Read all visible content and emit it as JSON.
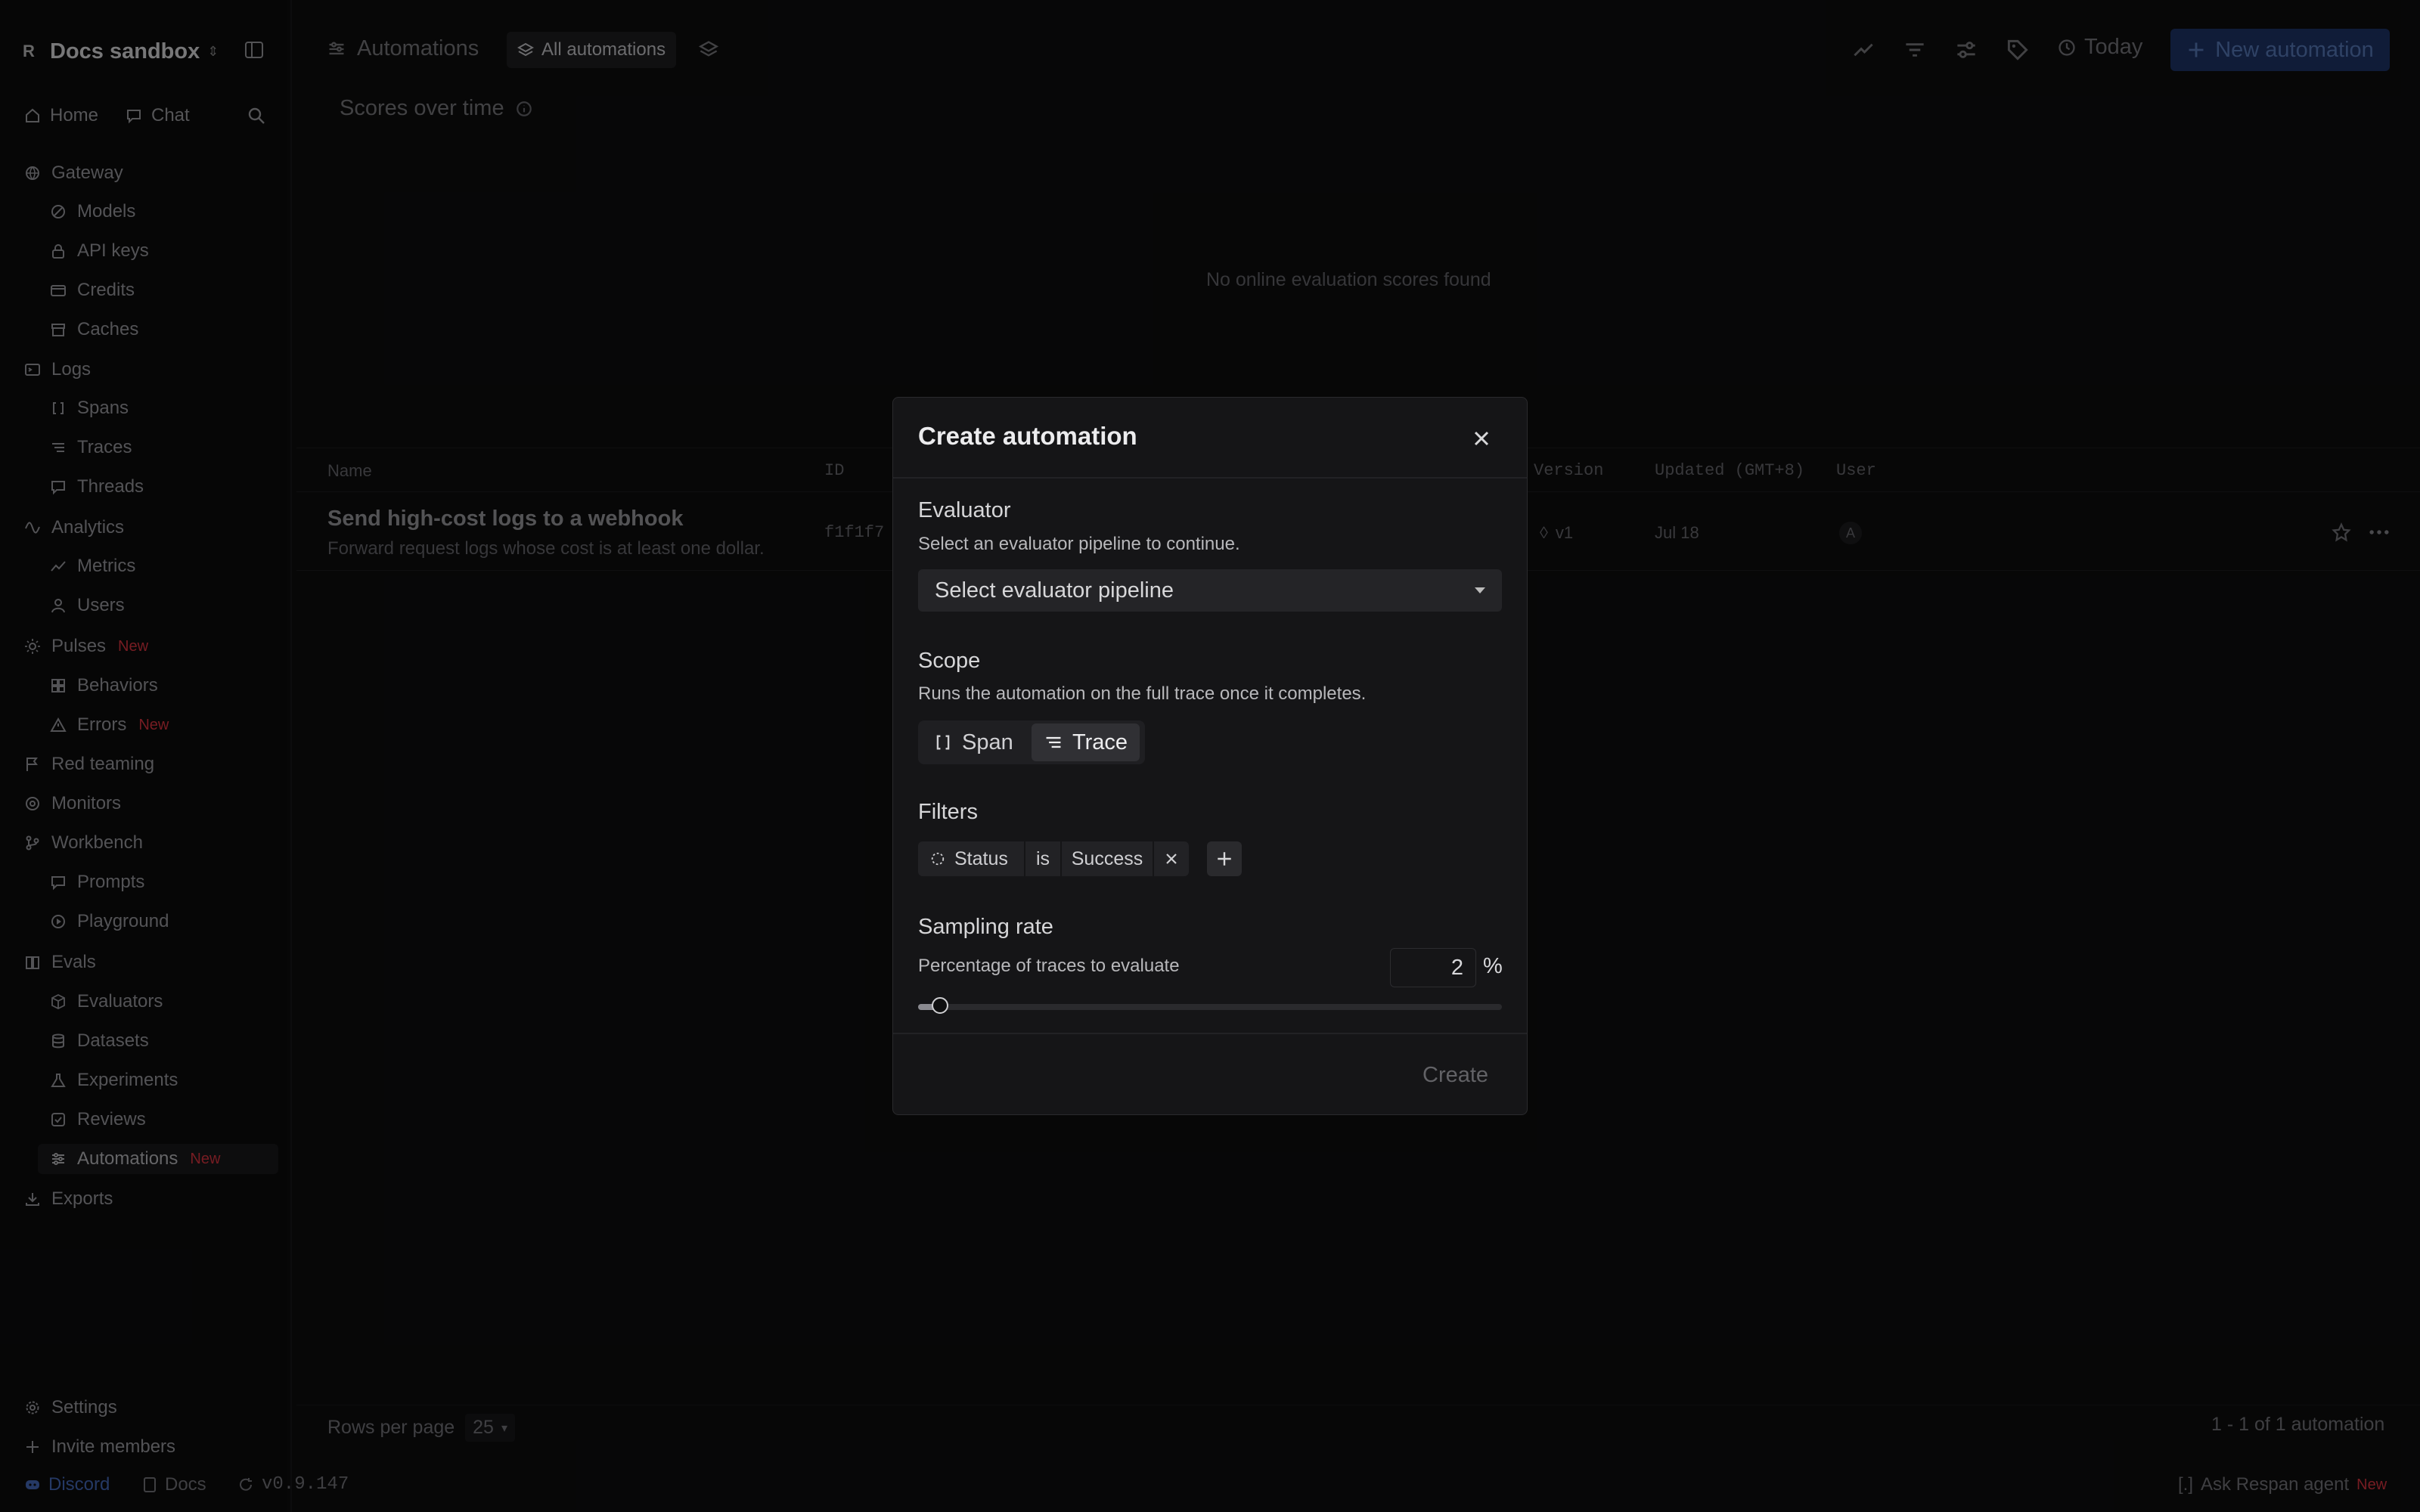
{
  "workspace": {
    "badge": "R",
    "name": "Docs sandbox"
  },
  "topnav": {
    "home": "Home",
    "chat": "Chat"
  },
  "sidebar": {
    "gateway": "Gateway",
    "models": "Models",
    "api_keys": "API keys",
    "credits": "Credits",
    "caches": "Caches",
    "logs": "Logs",
    "spans": "Spans",
    "traces": "Traces",
    "threads": "Threads",
    "analytics": "Analytics",
    "metrics": "Metrics",
    "users": "Users",
    "pulses": "Pulses",
    "behaviors": "Behaviors",
    "errors": "Errors",
    "red_teaming": "Red teaming",
    "monitors": "Monitors",
    "workbench": "Workbench",
    "prompts": "Prompts",
    "playground": "Playground",
    "evals": "Evals",
    "evaluators": "Evaluators",
    "datasets": "Datasets",
    "experiments": "Experiments",
    "reviews": "Reviews",
    "automations": "Automations",
    "exports": "Exports",
    "settings": "Settings",
    "invite": "Invite members",
    "new_badge": "New"
  },
  "bottom": {
    "discord": "Discord",
    "docs": "Docs",
    "version": "v0.9.147",
    "ask": "Ask Respan agent",
    "ask_badge": "New"
  },
  "header": {
    "section": "Automations",
    "tab": "All automations",
    "today": "Today",
    "new_button": "New automation"
  },
  "panel": {
    "title": "Scores over time",
    "empty": "No online evaluation scores found"
  },
  "table": {
    "columns": {
      "name": "Name",
      "id": "ID",
      "version": "Version",
      "updated": "Updated (GMT+8)",
      "user": "User"
    },
    "row": {
      "title": "Send high-cost logs to a webhook",
      "desc": "Forward request logs whose cost is at least one dollar.",
      "id": "f1f1f7",
      "version": "v1",
      "updated": "Jul 18",
      "user": "A"
    }
  },
  "pagination": {
    "rows_label": "Rows per page",
    "rows_value": "25",
    "summary": "1 - 1 of 1 automation"
  },
  "modal": {
    "title": "Create automation",
    "evaluator_label": "Evaluator",
    "evaluator_help": "Select an evaluator pipeline to continue.",
    "evaluator_placeholder": "Select evaluator pipeline",
    "scope_label": "Scope",
    "scope_help": "Runs the automation on the full trace once it completes.",
    "scope_options": [
      "Span",
      "Trace"
    ],
    "scope_selected": "Trace",
    "filters_label": "Filters",
    "filter": {
      "field": "Status",
      "op": "is",
      "value": "Success"
    },
    "sampling_label": "Sampling rate",
    "sampling_help": "Percentage of traces to evaluate",
    "sampling_value": "2",
    "sampling_unit": "%",
    "sampling_fraction": 0.02,
    "create_button": "Create"
  },
  "colors": {
    "accent": "#1b2f5e",
    "badge_new": "#c5303a",
    "modal_bg": "#151517"
  }
}
